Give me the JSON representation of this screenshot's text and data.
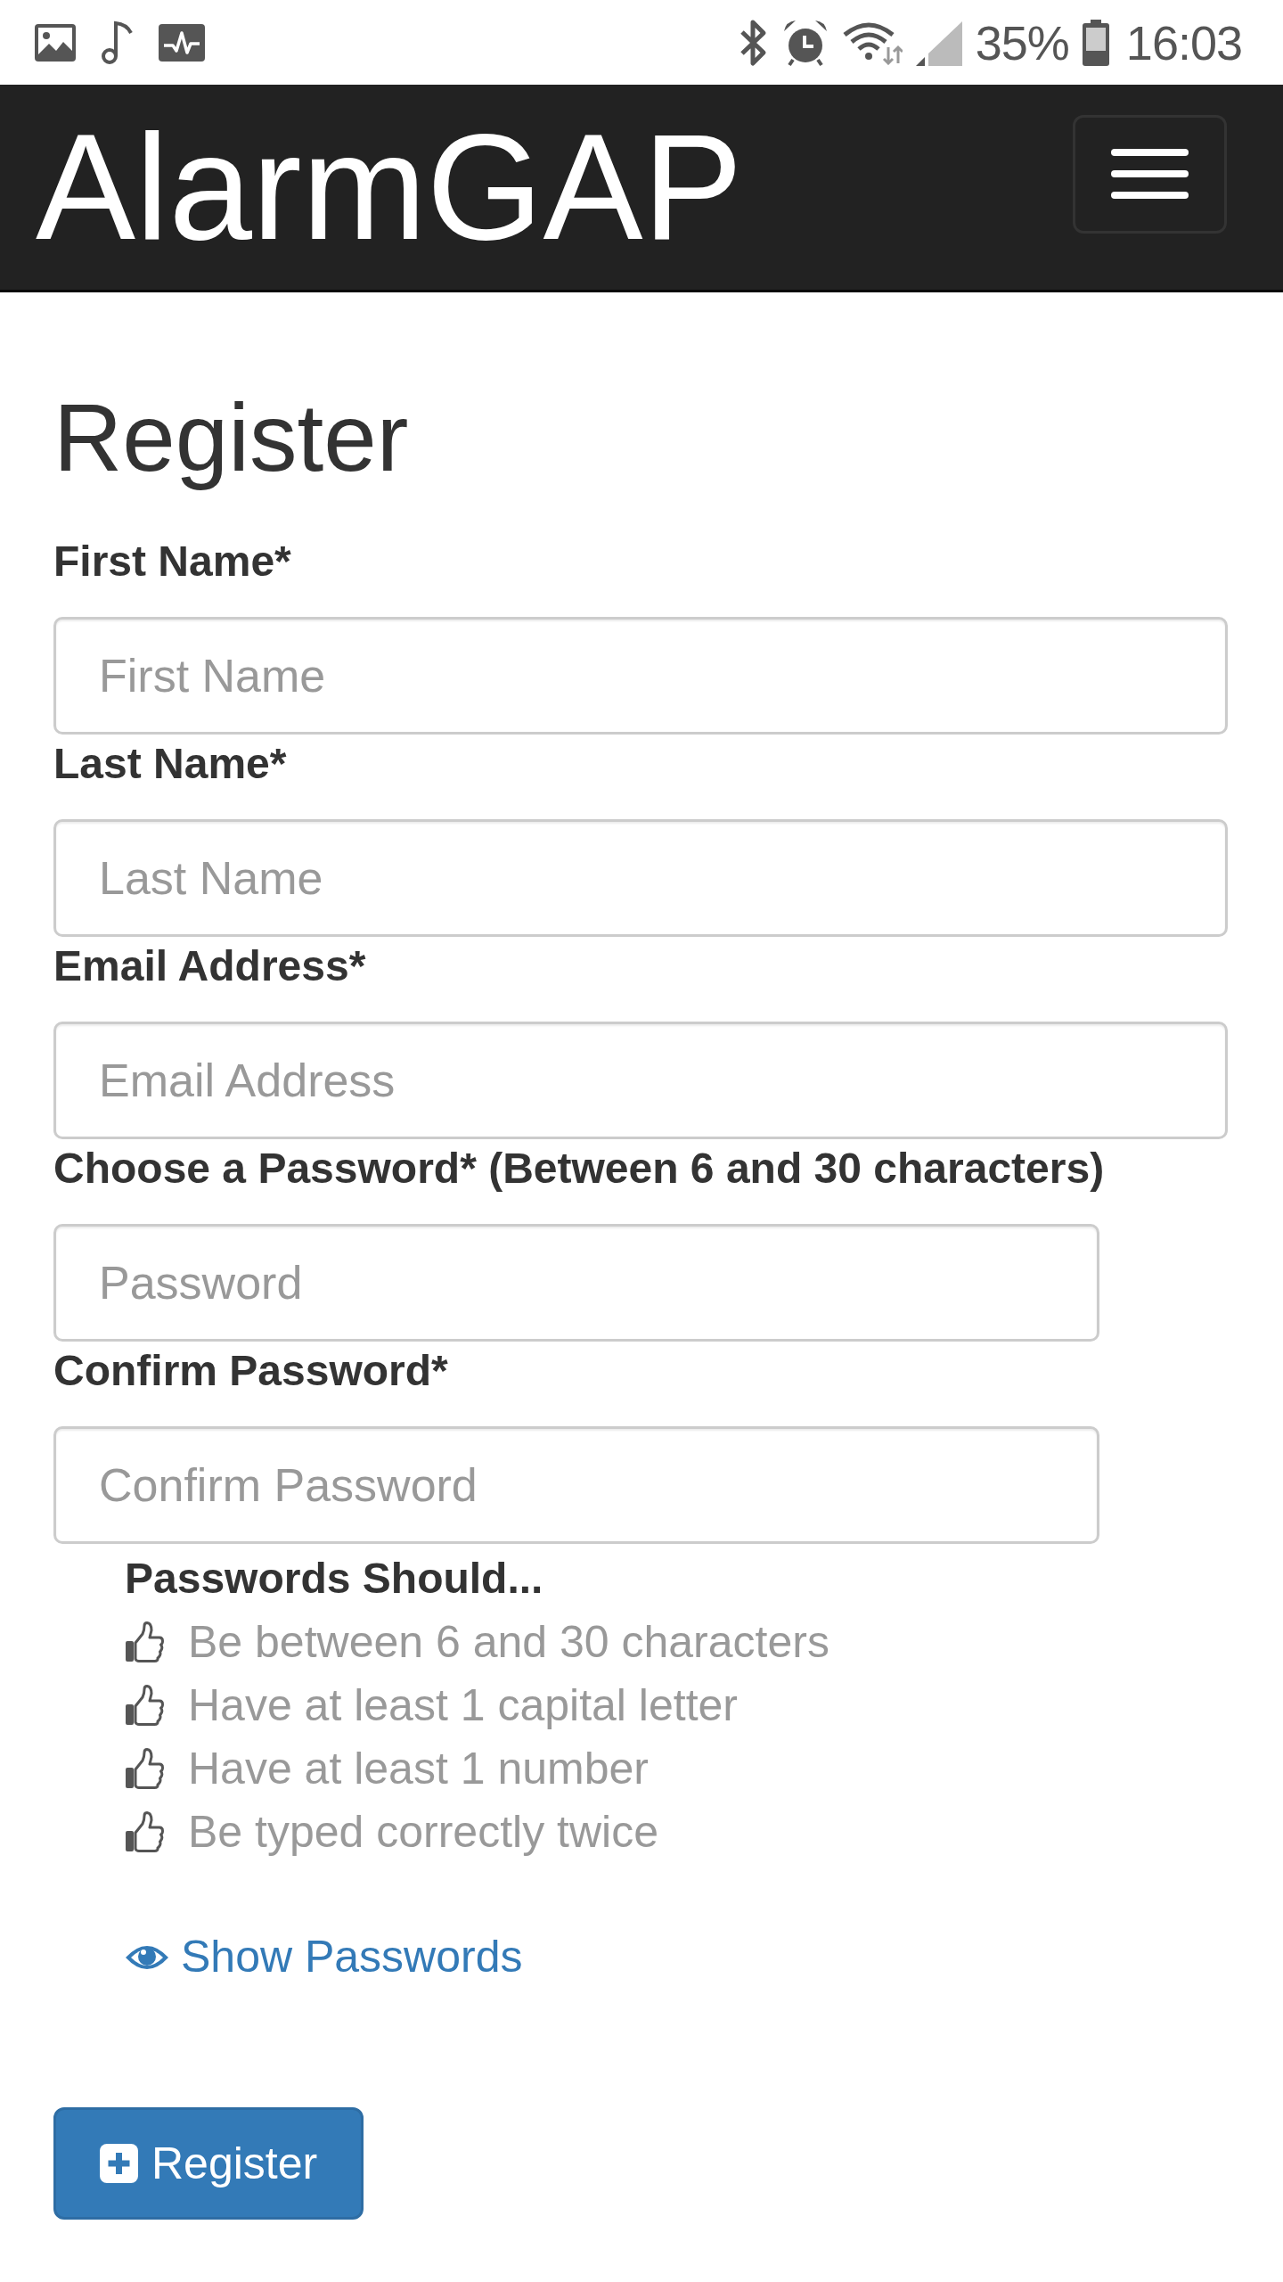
{
  "status_bar": {
    "battery": "35%",
    "time": "16:03"
  },
  "navbar": {
    "brand": "AlarmGAP"
  },
  "page": {
    "title": "Register"
  },
  "form": {
    "fields": [
      {
        "label": "First Name*",
        "placeholder": "First Name",
        "kind": "text"
      },
      {
        "label": "Last Name*",
        "placeholder": "Last Name",
        "kind": "text"
      },
      {
        "label": "Email Address*",
        "placeholder": "Email Address",
        "kind": "email"
      },
      {
        "label": "Choose a Password* (Between 6 and 30 characters)",
        "placeholder": "Password",
        "kind": "password"
      },
      {
        "label": "Confirm Password*",
        "placeholder": "Confirm Password",
        "kind": "password"
      }
    ],
    "password_rules": {
      "title": "Passwords Should...",
      "items": [
        "Be between 6 and 30 characters",
        "Have at least 1 capital letter",
        "Have at least 1 number",
        "Be typed correctly twice"
      ]
    },
    "show_passwords_link": "Show Passwords",
    "submit_button": "Register"
  }
}
